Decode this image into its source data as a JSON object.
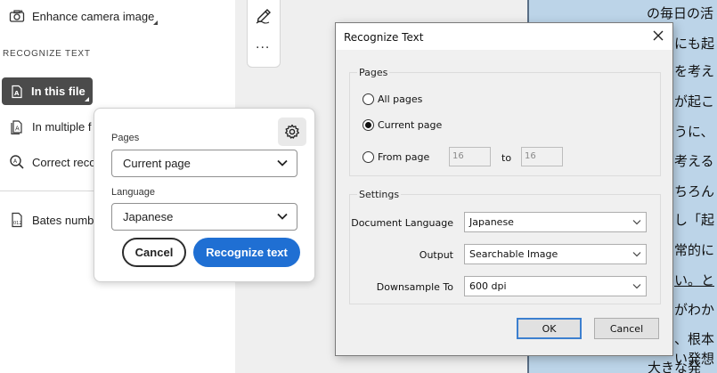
{
  "left_panel": {
    "enhance_label": "Enhance camera image",
    "section_heading": "RECOGNIZE TEXT",
    "in_this_file_label": "In this file",
    "in_multiple_label": "In multiple f",
    "correct_label": "Correct reco",
    "bates_label": "Bates numb"
  },
  "toolbar": {
    "more_label": "..."
  },
  "popover": {
    "pages_label": "Pages",
    "pages_value": "Current page",
    "language_label": "Language",
    "language_value": "Japanese",
    "cancel_label": "Cancel",
    "recognize_label": "Recognize text"
  },
  "dialog": {
    "title": "Recognize Text",
    "pages_group": "Pages",
    "all_pages": "All pages",
    "current_page": "Current page",
    "from_page": "From page",
    "from_value": "16",
    "to_label": "to",
    "to_value": "16",
    "settings_group": "Settings",
    "doc_language_label": "Document Language",
    "doc_language_value": "Japanese",
    "output_label": "Output",
    "output_value": "Searchable Image",
    "downsample_label": "Downsample To",
    "downsample_value": "600 dpi",
    "ok_label": "OK",
    "cancel_label": "Cancel"
  },
  "document": {
    "lines": [
      "の毎日の活",
      "にも起",
      "を考え",
      "が起こ",
      "うに、",
      "考える",
      "ちろん",
      "し「起",
      "常的に",
      "い。と",
      "がわか",
      "、根本",
      "い発想",
      "大きな発"
    ]
  },
  "colors": {
    "accent": "#1f6fd3",
    "active_pill": "#4b4b4b",
    "document_page": "#bcd4e8"
  }
}
